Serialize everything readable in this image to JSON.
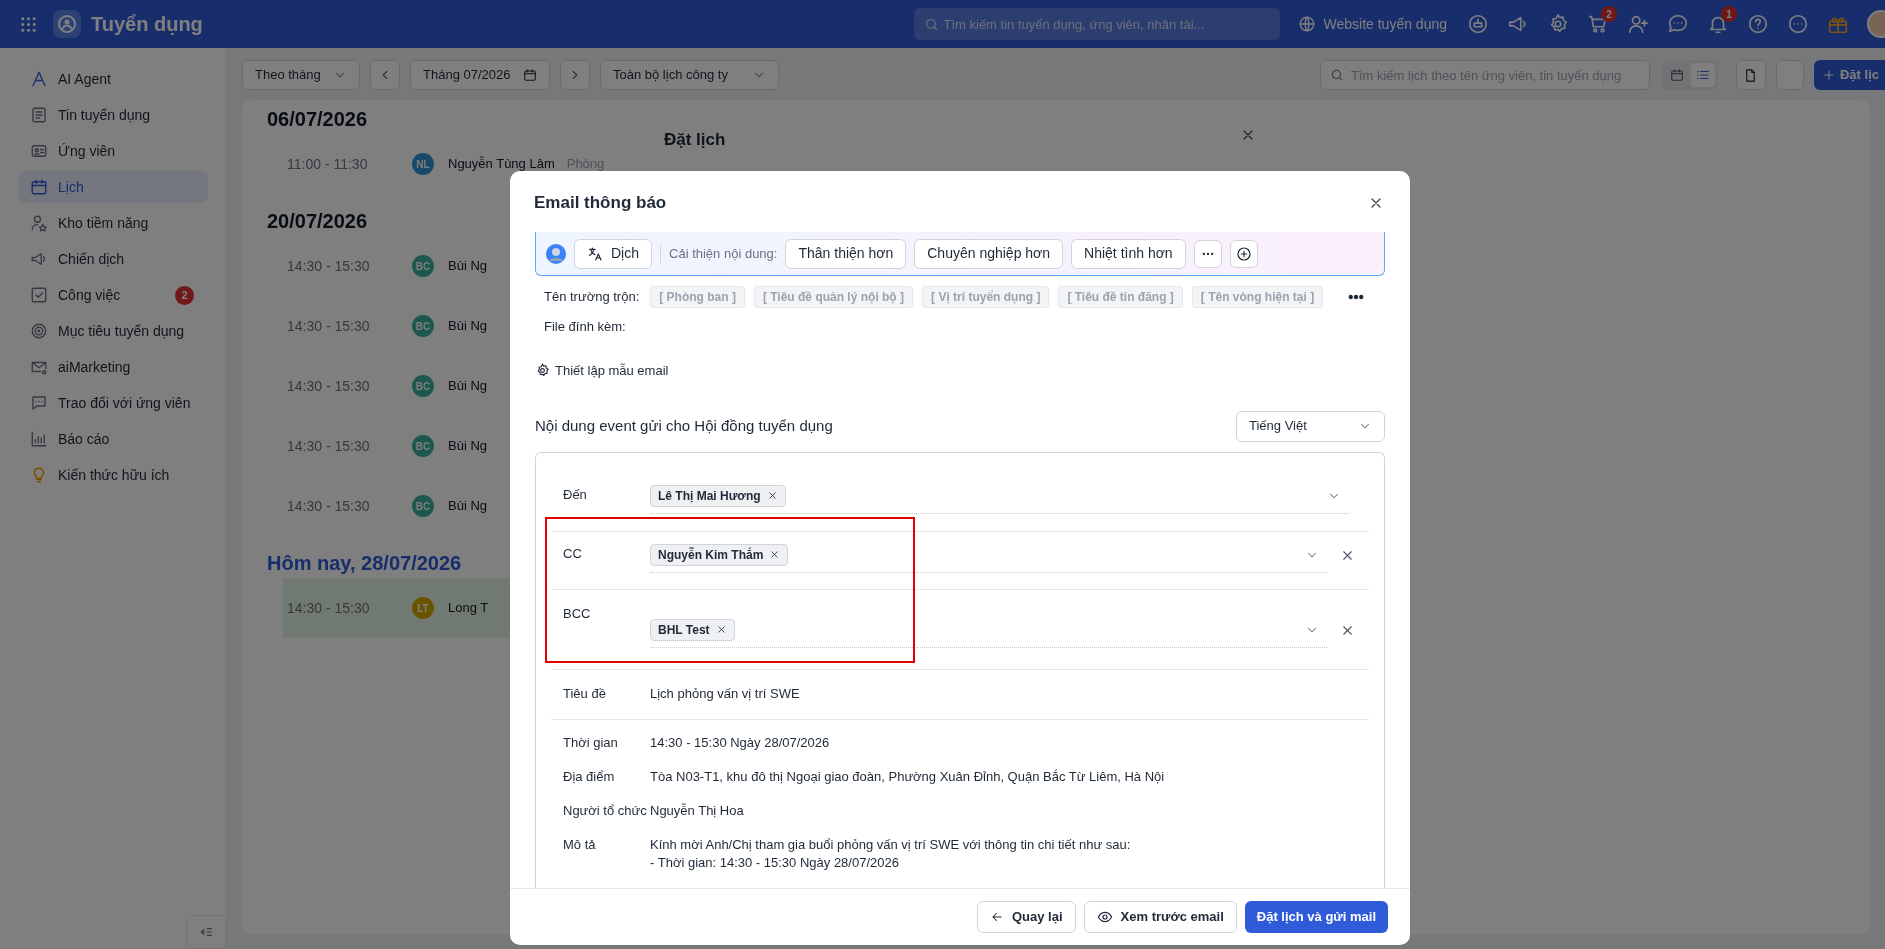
{
  "topbar": {
    "app_title": "Tuyển dụng",
    "search": {
      "placeholder": "Tìm kiếm tin tuyển dụng, ứng viên, nhân tài..."
    },
    "website_link": "Website tuyển dụng",
    "icons": [
      {
        "kind": "bot"
      },
      {
        "kind": "megaphone"
      },
      {
        "kind": "settings"
      },
      {
        "kind": "cart",
        "badge": "2"
      },
      {
        "kind": "user-plus"
      },
      {
        "kind": "chat"
      },
      {
        "kind": "bell",
        "badge": "1"
      },
      {
        "kind": "help"
      },
      {
        "kind": "more"
      },
      {
        "kind": "gift"
      },
      {
        "kind": "avatar"
      }
    ]
  },
  "sidebar": {
    "items": [
      {
        "label": "AI Agent",
        "selected": false
      },
      {
        "label": "Tin tuyển dụng",
        "selected": false
      },
      {
        "label": "Ứng viên",
        "selected": false
      },
      {
        "label": "Lịch",
        "selected": true
      },
      {
        "label": "Kho tiềm năng",
        "selected": false
      },
      {
        "label": "Chiến dịch",
        "selected": false
      },
      {
        "label": "Công việc",
        "selected": false,
        "badge": "2"
      },
      {
        "label": "Mục tiêu tuyển dụng",
        "selected": false
      },
      {
        "label": "aiMarketing",
        "selected": false
      },
      {
        "label": "Trao đổi với ứng viên",
        "selected": false
      },
      {
        "label": "Báo cáo",
        "selected": false
      },
      {
        "label": "Kiến thức hữu ích",
        "selected": false
      }
    ]
  },
  "toolbar": {
    "view_select": "Theo tháng",
    "month": "Tháng 07/2026",
    "scope_select": "Toàn bộ lịch công ty",
    "search": {
      "placeholder": "Tìm kiếm lịch theo tên ứng viên, tin tuyển dụng"
    },
    "view_toggle": [
      {
        "kind": "calendar",
        "selected": false
      },
      {
        "kind": "list",
        "selected": true
      }
    ],
    "add_button": "Đặt lịc"
  },
  "schedule": {
    "groups": [
      {
        "title": "06/07/2026",
        "today": false,
        "events": [
          {
            "time": "11:00 - 11:30",
            "initials": "NL",
            "color": "#18486a",
            "name": "Nguyễn Tùng Lâm",
            "detail": "Phòng",
            "highlighted": false
          }
        ]
      },
      {
        "title": "20/07/2026",
        "today": false,
        "events": [
          {
            "time": "14:30 - 15:30",
            "initials": "BC",
            "color": "#1c584d",
            "name": "Bùi Ng",
            "highlighted": false
          },
          {
            "time": "14:30 - 15:30",
            "initials": "BC",
            "color": "#1c584d",
            "name": "Bùi Ng",
            "highlighted": false
          },
          {
            "time": "14:30 - 15:30",
            "initials": "BC",
            "color": "#1c584d",
            "name": "Bùi Ng",
            "highlighted": false
          },
          {
            "time": "14:30 - 15:30",
            "initials": "BC",
            "color": "#1c584d",
            "name": "Bùi Ng",
            "highlighted": false
          },
          {
            "time": "14:30 - 15:30",
            "initials": "BC",
            "color": "#1c584d",
            "name": "Bùi Ng",
            "highlighted": false
          }
        ]
      },
      {
        "title": "Hôm nay, 28/07/2026",
        "today": true,
        "events": [
          {
            "time": "14:30 - 15:30",
            "initials": "LT",
            "color": "#6b5400",
            "name": "Long T",
            "highlighted": true
          }
        ]
      }
    ]
  },
  "background_dialog": {
    "title": "Đặt lịch"
  },
  "email_dialog": {
    "title": "Email thông báo",
    "ai_toolbar": {
      "translate_button": "Dịch",
      "improve_label": "Cải thiện nội dung:",
      "suggestions": [
        "Thân thiện hơn",
        "Chuyên nghiệp hơn",
        "Nhiệt tình hơn"
      ]
    },
    "merge_fields": {
      "label": "Tên trường trộn:",
      "tags": [
        "[ Phòng ban ]",
        "[ Tiêu đề quản lý nội bộ ]",
        "[ Vị trí tuyển dụng ]",
        "[ Tiêu đề tin đăng ]",
        "[ Tên vòng hiện tại ]"
      ]
    },
    "attachments_label": "File đính kèm:",
    "template_link": "Thiết lập mẫu email",
    "event_content": {
      "heading": "Nội dung event gửi cho Hội đồng tuyển dụng",
      "language": "Tiếng Việt"
    },
    "recipients": [
      {
        "label": "Đến",
        "chips": [
          "Lê Thị Mai Hương"
        ],
        "removable": false,
        "highlighted": false
      },
      {
        "label": "CC",
        "chips": [
          "Nguyễn Kim Thắm"
        ],
        "removable": true,
        "highlighted": true
      },
      {
        "label": "BCC",
        "chips": [
          "BHL Test"
        ],
        "removable": true,
        "highlighted": true
      }
    ],
    "subject": {
      "label": "Tiêu đề",
      "value": "Lịch phỏng vấn vị trí SWE"
    },
    "details": [
      {
        "label": "Thời gian",
        "lines": [
          "14:30 - 15:30 Ngày 28/07/2026"
        ]
      },
      {
        "label": "Địa điểm",
        "lines": [
          "Tòa N03-T1, khu đô thị Ngoại giao đoàn, Phường Xuân Đỉnh, Quận Bắc Từ Liêm, Hà Nội"
        ]
      },
      {
        "label": "Người tổ chức",
        "lines": [
          "Nguyễn Thị Hoa"
        ]
      },
      {
        "label": "Mô tả",
        "lines": [
          "Kính mời Anh/Chị tham gia buổi phỏng vấn vị trí SWE với thông tin chi tiết như sau:",
          "- Thời gian: 14:30 - 15:30 Ngày 28/07/2026"
        ]
      }
    ],
    "footer_buttons": [
      {
        "label": "Quay lại",
        "kind": "back"
      },
      {
        "label": "Xem trước email",
        "kind": "preview"
      },
      {
        "label": "Đặt lịch và gửi mail",
        "kind": "primary"
      }
    ]
  }
}
